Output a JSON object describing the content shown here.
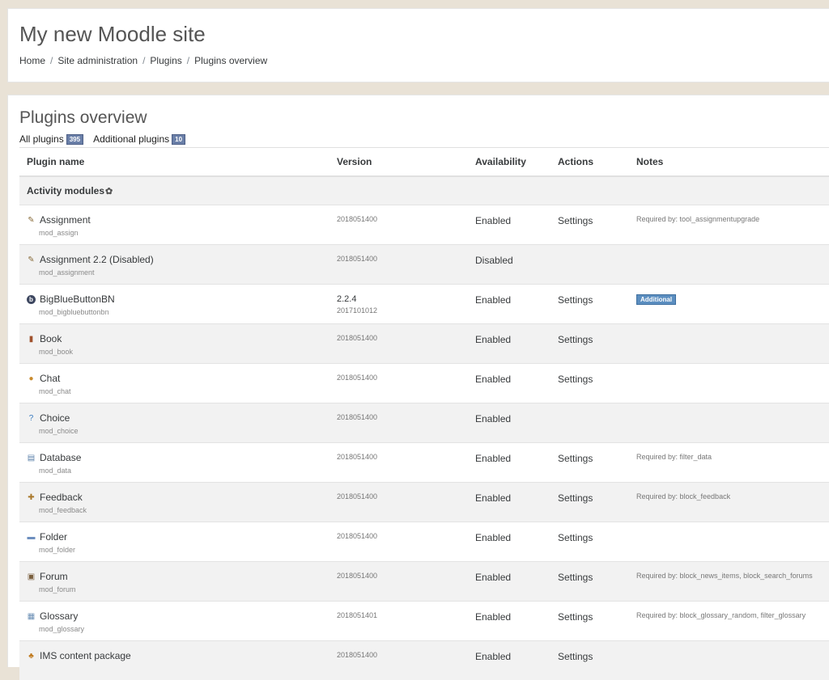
{
  "site": {
    "title": "My new Moodle site",
    "breadcrumb": [
      "Home",
      "Site administration",
      "Plugins",
      "Plugins overview"
    ]
  },
  "page": {
    "heading": "Plugins overview",
    "filters": {
      "all_label": "All plugins",
      "all_count": "395",
      "additional_label": "Additional plugins",
      "additional_count": "10"
    }
  },
  "table": {
    "headers": [
      "Plugin name",
      "Version",
      "Availability",
      "Actions",
      "Notes"
    ],
    "category": "Activity modules",
    "rows": [
      {
        "name": "Assignment",
        "component": "mod_assign",
        "release": "",
        "version": "2018051400",
        "availability": "Enabled",
        "action": "Settings",
        "note": "Required by: tool_assignmentupgrade",
        "badge": "",
        "icon": "assignment-icon"
      },
      {
        "name": "Assignment 2.2 (Disabled)",
        "component": "mod_assignment",
        "release": "",
        "version": "2018051400",
        "availability": "Disabled",
        "action": "",
        "note": "",
        "badge": "",
        "icon": "assignment-icon"
      },
      {
        "name": "BigBlueButtonBN",
        "component": "mod_bigbluebuttonbn",
        "release": "2.2.4",
        "version": "2017101012",
        "availability": "Enabled",
        "action": "Settings",
        "note": "",
        "badge": "Additional",
        "icon": "bigbluebutton-icon"
      },
      {
        "name": "Book",
        "component": "mod_book",
        "release": "",
        "version": "2018051400",
        "availability": "Enabled",
        "action": "Settings",
        "note": "",
        "badge": "",
        "icon": "book-icon"
      },
      {
        "name": "Chat",
        "component": "mod_chat",
        "release": "",
        "version": "2018051400",
        "availability": "Enabled",
        "action": "Settings",
        "note": "",
        "badge": "",
        "icon": "chat-icon"
      },
      {
        "name": "Choice",
        "component": "mod_choice",
        "release": "",
        "version": "2018051400",
        "availability": "Enabled",
        "action": "",
        "note": "",
        "badge": "",
        "icon": "choice-icon"
      },
      {
        "name": "Database",
        "component": "mod_data",
        "release": "",
        "version": "2018051400",
        "availability": "Enabled",
        "action": "Settings",
        "note": "Required by: filter_data",
        "badge": "",
        "icon": "database-icon"
      },
      {
        "name": "Feedback",
        "component": "mod_feedback",
        "release": "",
        "version": "2018051400",
        "availability": "Enabled",
        "action": "Settings",
        "note": "Required by: block_feedback",
        "badge": "",
        "icon": "feedback-icon"
      },
      {
        "name": "Folder",
        "component": "mod_folder",
        "release": "",
        "version": "2018051400",
        "availability": "Enabled",
        "action": "Settings",
        "note": "",
        "badge": "",
        "icon": "folder-icon"
      },
      {
        "name": "Forum",
        "component": "mod_forum",
        "release": "",
        "version": "2018051400",
        "availability": "Enabled",
        "action": "Settings",
        "note": "Required by: block_news_items, block_search_forums",
        "badge": "",
        "icon": "forum-icon"
      },
      {
        "name": "Glossary",
        "component": "mod_glossary",
        "release": "",
        "version": "2018051401",
        "availability": "Enabled",
        "action": "Settings",
        "note": "Required by: block_glossary_random, filter_glossary",
        "badge": "",
        "icon": "glossary-icon"
      },
      {
        "name": "IMS content package",
        "component": "",
        "release": "",
        "version": "2018051400",
        "availability": "Enabled",
        "action": "Settings",
        "note": "",
        "badge": "",
        "icon": "ims-package-icon"
      }
    ]
  },
  "colors": {
    "page_background": "#e9e2d6",
    "badge_blue": "#6a7fa8",
    "additional_badge": "#5b8ec0",
    "row_stripe": "#f2f2f2"
  }
}
